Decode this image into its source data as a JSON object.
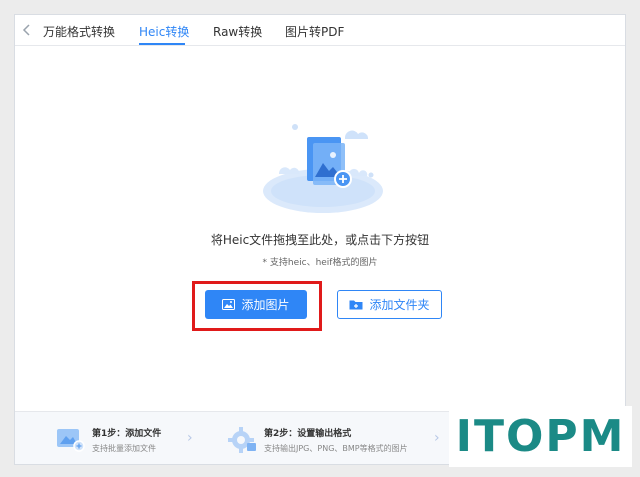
{
  "tabs": [
    {
      "label": "万能格式转换",
      "active": false
    },
    {
      "label": "Heic转换",
      "active": true
    },
    {
      "label": "Raw转换",
      "active": false
    },
    {
      "label": "图片转PDF",
      "active": false
    }
  ],
  "main": {
    "hint": "将Heic文件拖拽至此处，或点击下方按钮",
    "sub_hint": "* 支持heic、heif格式的图片",
    "add_image_label": "添加图片",
    "add_folder_label": "添加文件夹"
  },
  "steps": [
    {
      "title": "第1步：添加文件",
      "desc": "支持批量添加文件",
      "icon": "image-add-icon"
    },
    {
      "title": "第2步：设置输出格式",
      "desc": "支持输出JPG、PNG、BMP等格式的图片",
      "icon": "gear-icon"
    }
  ],
  "watermark": "ITOPM",
  "colors": {
    "accent": "#2f86f6",
    "highlight": "#e01a1a",
    "watermark": "#1b8a86"
  }
}
